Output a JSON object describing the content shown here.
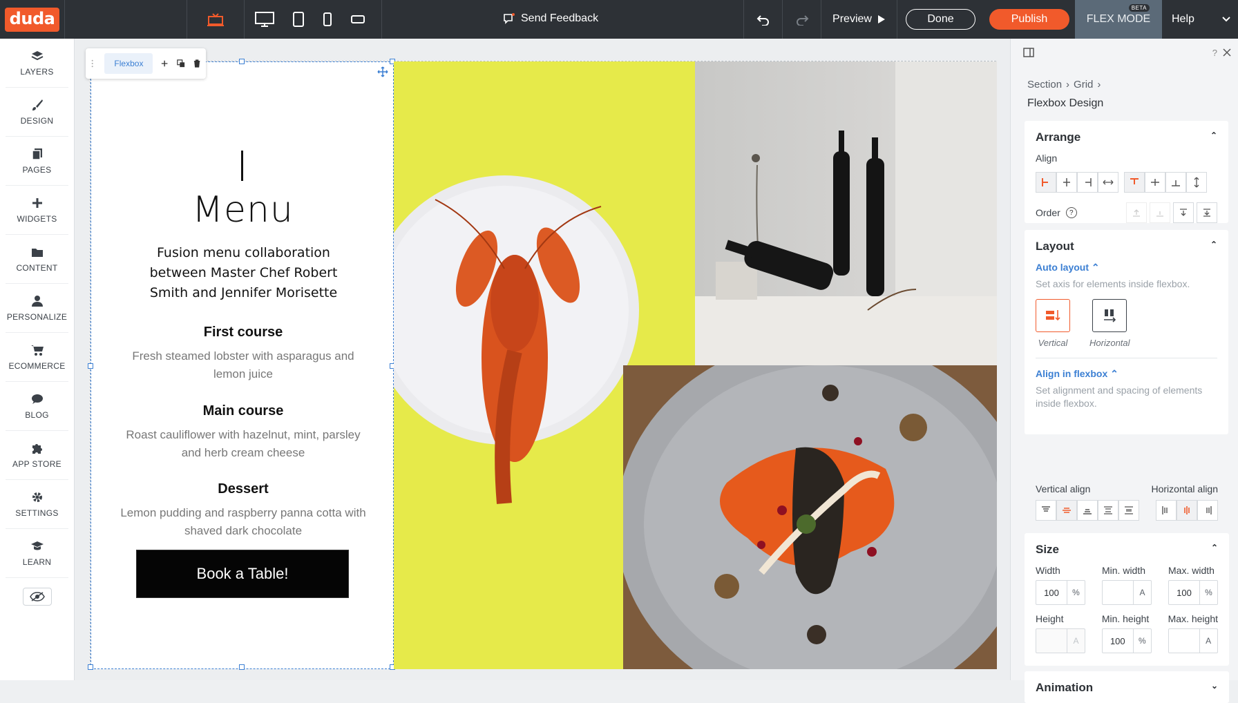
{
  "app": {
    "logo_text": "duda",
    "brand_color": "#f15a2b"
  },
  "topbar": {
    "devices": [
      "display-icon",
      "desktop-icon",
      "tablet-icon",
      "mobile-icon",
      "mobile-landscape-icon"
    ],
    "feedback_label": "Send Feedback",
    "preview_label": "Preview",
    "done_label": "Done",
    "publish_label": "Publish",
    "flex_mode_label": "FLEX MODE",
    "beta_label": "BETA",
    "help_label": "Help"
  },
  "sidebar": {
    "items": [
      {
        "label": "LAYERS",
        "icon": "layers-icon"
      },
      {
        "label": "DESIGN",
        "icon": "brush-icon"
      },
      {
        "label": "PAGES",
        "icon": "pages-icon"
      },
      {
        "label": "WIDGETS",
        "icon": "plus-icon"
      },
      {
        "label": "CONTENT",
        "icon": "folder-icon"
      },
      {
        "label": "PERSONALIZE",
        "icon": "person-icon"
      },
      {
        "label": "ECOMMERCE",
        "icon": "cart-icon"
      },
      {
        "label": "BLOG",
        "icon": "chat-icon"
      },
      {
        "label": "APP STORE",
        "icon": "puzzle-icon"
      },
      {
        "label": "SETTINGS",
        "icon": "gear-icon"
      },
      {
        "label": "LEARN",
        "icon": "graduation-icon"
      }
    ]
  },
  "canvas": {
    "toolbar_tag": "Flexbox",
    "menu_title": "Menu",
    "menu_desc": "Fusion menu collaboration between Master Chef Robert Smith and Jennifer Morisette",
    "courses": [
      {
        "title": "First course",
        "desc": "Fresh steamed lobster with asparagus and lemon juice"
      },
      {
        "title": "Main course",
        "desc": "Roast cauliflower with hazelnut, mint, parsley and herb cream cheese"
      },
      {
        "title": "Dessert",
        "desc": "Lemon pudding and raspberry panna cotta with shaved dark chocolate"
      }
    ],
    "book_label": "Book a Table!"
  },
  "panel": {
    "breadcrumb": [
      "Section",
      "Grid"
    ],
    "title": "Flexbox Design",
    "arrange": {
      "title": "Arrange",
      "align_label": "Align",
      "order_label": "Order"
    },
    "layout": {
      "title": "Layout",
      "auto_layout_label": "Auto layout",
      "auto_layout_desc": "Set axis for elements inside flexbox.",
      "vertical_label": "Vertical",
      "horizontal_label": "Horizontal",
      "align_in_flexbox_label": "Align in flexbox",
      "align_in_flexbox_desc": "Set alignment and spacing of elements inside flexbox.",
      "vertical_align_label": "Vertical align",
      "horizontal_align_label": "Horizontal align"
    },
    "size": {
      "title": "Size",
      "width_label": "Width",
      "width_value": "100",
      "width_unit": "%",
      "min_width_label": "Min. width",
      "min_width_value": "",
      "min_width_unit": "A",
      "max_width_label": "Max. width",
      "max_width_value": "100",
      "max_width_unit": "%",
      "height_label": "Height",
      "height_value": "",
      "height_unit": "A",
      "min_height_label": "Min. height",
      "min_height_value": "100",
      "min_height_unit": "%",
      "max_height_label": "Max. height",
      "max_height_value": "",
      "max_height_unit": "A"
    },
    "animation": {
      "title": "Animation"
    }
  }
}
